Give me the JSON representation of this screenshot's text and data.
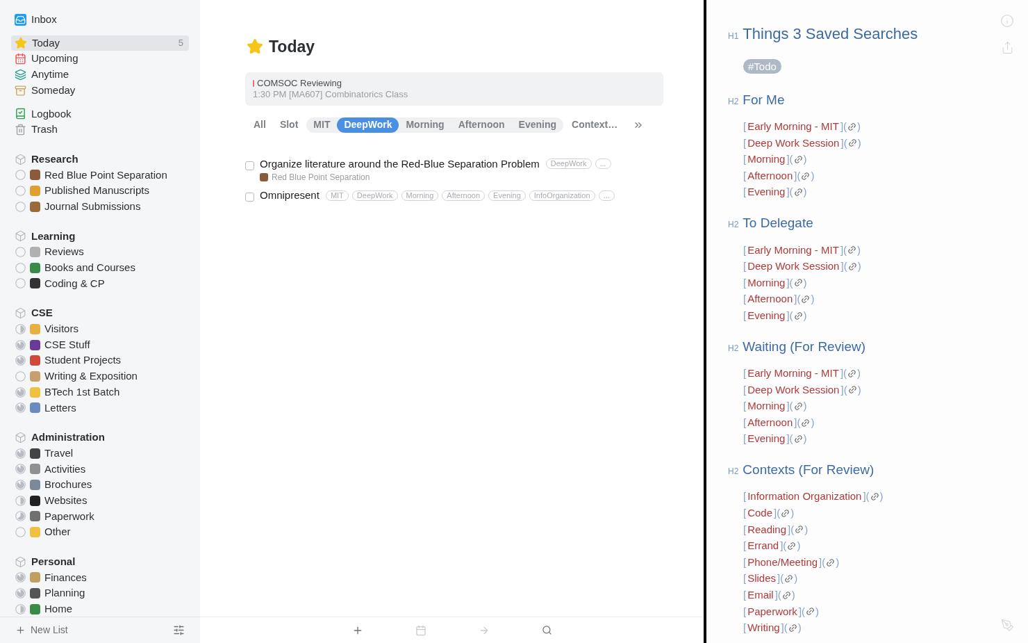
{
  "sidebar": {
    "nav_groups": [
      [
        {
          "label": "Inbox",
          "selected": false
        }
      ],
      [
        {
          "label": "Today",
          "selected": true,
          "count": "5"
        },
        {
          "label": "Upcoming",
          "selected": false
        },
        {
          "label": "Anytime",
          "selected": false
        },
        {
          "label": "Someday",
          "selected": false
        }
      ],
      [
        {
          "label": "Logbook",
          "selected": false
        },
        {
          "label": "Trash",
          "selected": false
        }
      ]
    ],
    "areas": [
      {
        "title": "Research",
        "projects": [
          {
            "label": "Red Blue Point Separation",
            "kind": "empty",
            "color": "#8b5a3c"
          },
          {
            "label": "Published Manuscripts",
            "kind": "empty",
            "color": "#e0a030"
          },
          {
            "label": "Journal Submissions",
            "kind": "empty",
            "color": "#9a6a3a"
          }
        ]
      },
      {
        "title": "Learning",
        "projects": [
          {
            "label": "Reviews",
            "kind": "empty",
            "color": "#b0b0b0"
          },
          {
            "label": "Books and Courses",
            "kind": "empty",
            "color": "#3a8a4a"
          },
          {
            "label": "Coding & CP",
            "kind": "empty",
            "color": "#333333"
          }
        ]
      },
      {
        "title": "CSE",
        "projects": [
          {
            "label": "Visitors",
            "kind": "half",
            "color": "#e8b040"
          },
          {
            "label": "CSE Stuff",
            "kind": "most",
            "color": "#6a3a9a"
          },
          {
            "label": "Student Projects",
            "kind": "most",
            "color": "#d04a3a"
          },
          {
            "label": "Writing & Exposition",
            "kind": "empty",
            "color": "#c8a070"
          },
          {
            "label": "BTech 1st Batch",
            "kind": "most",
            "color": "#f0c040"
          },
          {
            "label": "Letters",
            "kind": "most",
            "color": "#6a8ac0"
          }
        ]
      },
      {
        "title": "Administration",
        "projects": [
          {
            "label": "Travel",
            "kind": "most",
            "color": "#444444"
          },
          {
            "label": "Activities",
            "kind": "most",
            "color": "#909090"
          },
          {
            "label": "Brochures",
            "kind": "most",
            "color": "#7a8a9a"
          },
          {
            "label": "Websites",
            "kind": "half",
            "color": "#222222"
          },
          {
            "label": "Paperwork",
            "kind": "partial",
            "color": "#707070"
          },
          {
            "label": "Other",
            "kind": "empty",
            "color": "#f0c040"
          }
        ]
      },
      {
        "title": "Personal",
        "projects": [
          {
            "label": "Finances",
            "kind": "most",
            "color": "#c0a060"
          },
          {
            "label": "Planning",
            "kind": "most",
            "color": "#555555"
          },
          {
            "label": "Home",
            "kind": "half",
            "color": "#3a8a4a"
          }
        ]
      }
    ],
    "new_list": "New List"
  },
  "main": {
    "title": "Today",
    "calendar": {
      "event": "COMSOC Reviewing",
      "class": "1:30 PM [MA607] Combinatorics Class"
    },
    "filters": [
      {
        "label": "All",
        "grouped": false,
        "selected": false
      },
      {
        "label": "Slot",
        "grouped": false,
        "selected": false
      },
      {
        "label": "MIT",
        "grouped": true,
        "selected": false
      },
      {
        "label": "DeepWork",
        "grouped": true,
        "selected": true
      },
      {
        "label": "Morning",
        "grouped": true,
        "selected": false
      },
      {
        "label": "Afternoon",
        "grouped": true,
        "selected": false
      },
      {
        "label": "Evening",
        "grouped": true,
        "selected": false
      },
      {
        "label": "Context…",
        "grouped": false,
        "selected": false
      }
    ],
    "tasks": [
      {
        "title": "Organize literature around the Red-Blue Separation Problem",
        "checked": false,
        "tags": [
          "DeepWork",
          "..."
        ],
        "project": "Red Blue Point Separation"
      },
      {
        "title": "Omnipresent",
        "checked": false,
        "tags": [
          "MIT",
          "DeepWork",
          "Morning",
          "Afternoon",
          "Evening",
          "InfoOrganization",
          "..."
        ]
      }
    ]
  },
  "note": {
    "title": {
      "marker": "H1",
      "text": "Things 3 Saved Searches"
    },
    "tag": "#Todo",
    "sections": [
      {
        "marker": "H2",
        "heading": "For Me",
        "links": [
          {
            "open": "[",
            "label": "Early Morning - MIT",
            "mid": "](",
            "close": ")"
          },
          {
            "open": "[",
            "label": "Deep Work Session",
            "mid": "](",
            "close": ")"
          },
          {
            "open": "[",
            "label": "Morning",
            "mid": "](",
            "close": ")"
          },
          {
            "open": "[",
            "label": "Afternoon",
            "mid": "](",
            "close": ")"
          },
          {
            "open": "[",
            "label": "Evening",
            "mid": "](",
            "close": ")"
          }
        ]
      },
      {
        "marker": "H2",
        "heading": "To Delegate",
        "links": [
          {
            "open": "[",
            "label": "Early Morning - MIT",
            "mid": "](",
            "close": ")"
          },
          {
            "open": "[",
            "label": "Deep Work Session",
            "mid": "](",
            "close": ")"
          },
          {
            "open": "[",
            "label": "Morning",
            "mid": "](",
            "close": ")"
          },
          {
            "open": "[",
            "label": "Afternoon",
            "mid": "](",
            "close": ")"
          },
          {
            "open": "[",
            "label": "Evening",
            "mid": "](",
            "close": ")"
          }
        ]
      },
      {
        "marker": "H2",
        "heading": "Waiting (For Review)",
        "links": [
          {
            "open": "[",
            "label": "Early Morning - MIT",
            "mid": "](",
            "close": ")"
          },
          {
            "open": "[",
            "label": "Deep Work Session",
            "mid": "](",
            "close": ")"
          },
          {
            "open": "[",
            "label": "Morning",
            "mid": "](",
            "close": ")"
          },
          {
            "open": "[",
            "label": "Afternoon",
            "mid": "](",
            "close": ")"
          },
          {
            "open": "[",
            "label": "Evening",
            "mid": "](",
            "close": ")"
          }
        ]
      },
      {
        "marker": "H2",
        "heading": "Contexts (For Review)",
        "links": [
          {
            "open": "[",
            "label": "Information Organization",
            "mid": "](",
            "close": ")"
          },
          {
            "open": "[",
            "label": "Code",
            "mid": "](",
            "close": ")"
          },
          {
            "open": "[",
            "label": "Reading",
            "mid": "](",
            "close": ")"
          },
          {
            "open": "[",
            "label": "Errand",
            "mid": "](",
            "close": ")"
          },
          {
            "open": "[",
            "label": "Phone/Meeting",
            "mid": "](",
            "close": ")"
          },
          {
            "open": "[",
            "label": "Slides",
            "mid": "](",
            "close": ")"
          },
          {
            "open": "[",
            "label": "Email",
            "mid": "](",
            "close": ")"
          },
          {
            "open": "[",
            "label": "Paperwork",
            "mid": "](",
            "close": ")"
          },
          {
            "open": "[",
            "label": "Writing",
            "mid": "](",
            "close": ")"
          }
        ]
      }
    ]
  }
}
